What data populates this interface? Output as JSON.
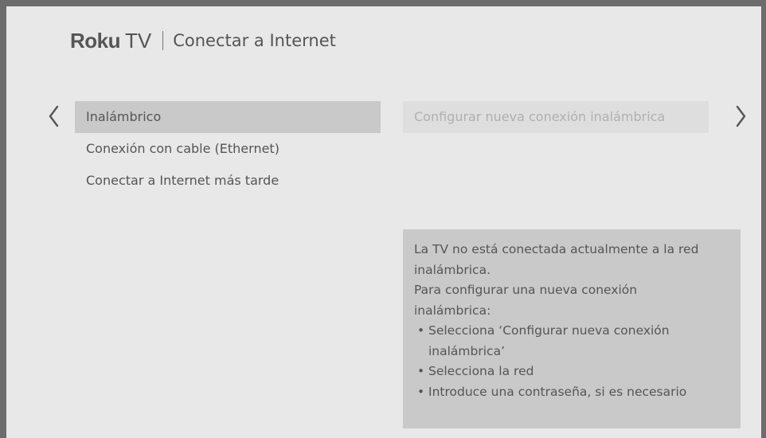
{
  "header": {
    "brand_roku": "Roku",
    "brand_tv": "TV",
    "title": "Conectar a Internet"
  },
  "menu": {
    "items": [
      {
        "label": "Inalámbrico",
        "selected": true
      },
      {
        "label": "Conexión con cable (Ethernet)",
        "selected": false
      },
      {
        "label": "Conectar a Internet más tarde",
        "selected": false
      }
    ]
  },
  "submenu": {
    "label": "Configurar nueva conexión inalámbrica"
  },
  "info": {
    "line1": "La TV no está conectada actualmente a la red",
    "line2": "inalámbrica.",
    "line3": "Para configurar una nueva conexión",
    "line4": "inalámbrica:",
    "bullets": [
      "Selecciona ‘Configurar nueva conexión inalámbrica’",
      "Selecciona la red",
      "Introduce una contraseña, si es necesario"
    ],
    "bullet_mark": "•"
  },
  "icons": {
    "left": "chevron-left-icon",
    "right": "chevron-right-icon"
  },
  "colors": {
    "background": "#e8e8e8",
    "selected": "#c9c9c9",
    "text": "#555555",
    "frame": "#6c6c6c"
  }
}
